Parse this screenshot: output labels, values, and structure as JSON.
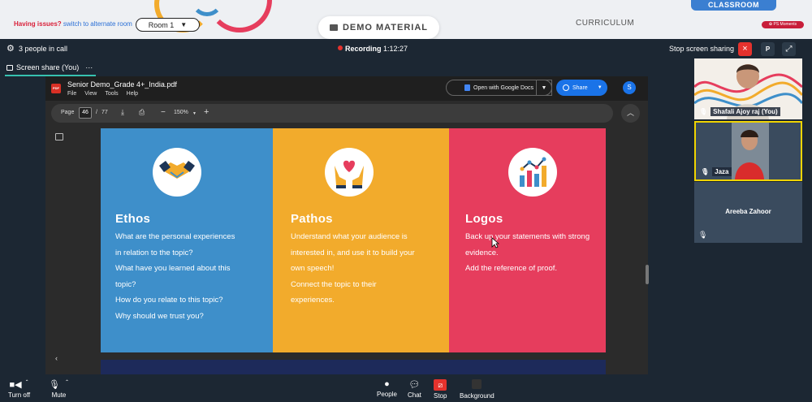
{
  "topbar": {
    "issues_text": "Having issues?",
    "alternate_link": "switch to alternate room",
    "room_label": "Room 1",
    "demo_label": "DEMO MATERIAL",
    "curriculum_label": "CURRICULUM",
    "classroom_label": "CLASSROOM",
    "ps_moments_label": "PS Moments"
  },
  "callbar": {
    "people_count": "3 people in call",
    "recording_label": "Recording",
    "recording_time": "1:12:27",
    "stop_sharing_label": "Stop screen sharing",
    "stop_icon": "×",
    "p_label": "P"
  },
  "screen_share_tab": {
    "label": "Screen share (You)",
    "more": "···"
  },
  "pdf": {
    "badge": "PDF",
    "filename": "Senior Demo_Grade 4+_India.pdf",
    "menu": [
      "File",
      "View",
      "Tools",
      "Help"
    ],
    "open_with_label": "Open with Google Docs",
    "share_label": "Share",
    "avatar_letter": "S",
    "page_label": "Page",
    "current_page": "46",
    "page_separator": "/",
    "total_pages": "77",
    "zoom_minus": "−",
    "zoom_value": "150%",
    "zoom_plus": "+"
  },
  "slide": {
    "panels": [
      {
        "title": "Ethos",
        "body": "What are the personal experiences\nin relation to the topic?\nWhat have you learned about this\ntopic?\nHow do you relate to this topic?\nWhy should we trust you?",
        "color": "#3e8fca",
        "icon": "handshake-icon"
      },
      {
        "title": "Pathos",
        "body": "Understand what your audience is\ninterested in, and use it to build your\nown speech!\nConnect the topic to their\nexperiences.",
        "color": "#f2ab2c",
        "icon": "heart-hands-icon"
      },
      {
        "title": "Logos",
        "body": "Back up your statements with strong\nevidence.\nAdd the reference of proof.",
        "color": "#e63d5d",
        "icon": "bar-chart-icon"
      }
    ]
  },
  "participants": [
    {
      "name": "Shafali Ajoy raj (You)"
    },
    {
      "name": "Jaza"
    },
    {
      "name": "Areeba Zahoor"
    }
  ],
  "toolbar": {
    "turn_off": "Turn off",
    "mute": "Mute",
    "people": "People",
    "chat": "Chat",
    "stop": "Stop",
    "background": "Background"
  }
}
